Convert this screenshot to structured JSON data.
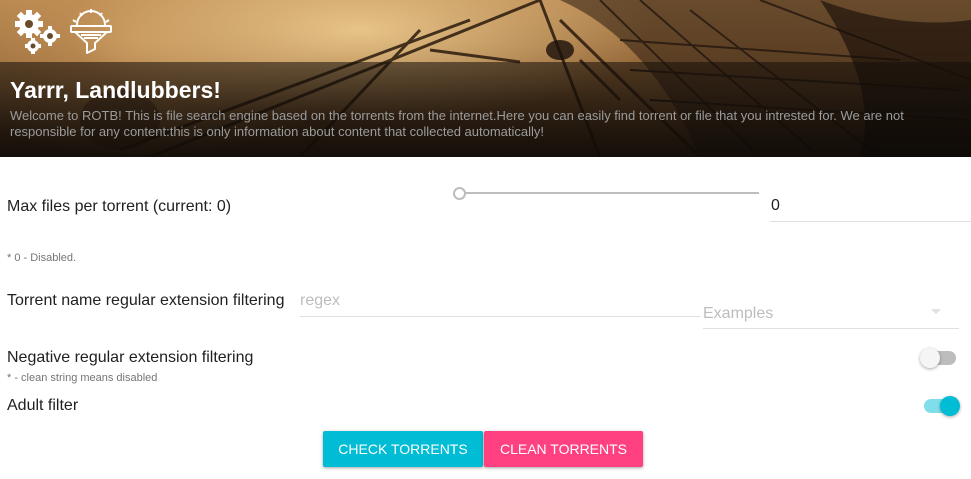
{
  "header": {
    "title": "Yarrr, Landlubbers!",
    "description": "Welcome to ROTB! This is file search engine based on the torrents from the internet.Here you can easily find torrent or file that you intrested for. We are not responsible for any content:this is only information about content that collected automatically!",
    "icons": [
      "settings-gears-icon",
      "filter-icon"
    ]
  },
  "settings": {
    "max_files": {
      "label": "Max files per torrent (current: 0)",
      "value": "0",
      "slider_value": 0,
      "hint": "* 0 - Disabled."
    },
    "regex_filter": {
      "label": "Torrent name regular extension filtering",
      "placeholder": "regex",
      "value": "",
      "examples_label": "Examples"
    },
    "negative_filter": {
      "label": "Negative regular extension filtering",
      "hint": "* - clean string means disabled",
      "enabled": false
    },
    "adult_filter": {
      "label": "Adult filter",
      "enabled": true
    }
  },
  "actions": {
    "check_label": "CHECK TORRENTS",
    "clean_label": "CLEAN TORRENTS"
  },
  "colors": {
    "accent": "#00bcd4",
    "secondary": "#ff4081"
  }
}
